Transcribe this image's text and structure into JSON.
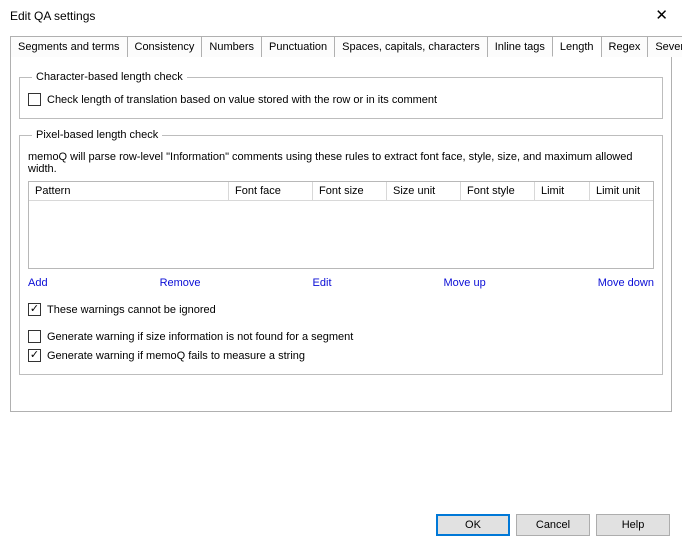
{
  "window": {
    "title": "Edit QA settings",
    "close_glyph": "✕"
  },
  "tabs": {
    "items": [
      {
        "label": "Segments and terms"
      },
      {
        "label": "Consistency"
      },
      {
        "label": "Numbers"
      },
      {
        "label": "Punctuation"
      },
      {
        "label": "Spaces, capitals, characters"
      },
      {
        "label": "Inline tags"
      },
      {
        "label": "Length"
      },
      {
        "label": "Regex"
      },
      {
        "label": "Severity"
      }
    ],
    "active_index": 6
  },
  "groups": {
    "char": {
      "legend": "Character-based length check",
      "checkbox_label": "Check length of translation based on value stored with the row or in its comment",
      "checked": false
    },
    "pixel": {
      "legend": "Pixel-based length check",
      "description": "memoQ will parse row-level \"Information\" comments using these rules to extract font face, style, size, and maximum allowed width.",
      "columns": {
        "pattern": "Pattern",
        "font_face": "Font face",
        "font_size": "Font size",
        "size_unit": "Size unit",
        "font_style": "Font style",
        "limit": "Limit",
        "limit_unit": "Limit unit"
      },
      "links": {
        "add": "Add",
        "remove": "Remove",
        "edit": "Edit",
        "move_up": "Move up",
        "move_down": "Move down"
      },
      "cb1": {
        "label": "These warnings cannot be ignored",
        "checked": true
      },
      "cb2": {
        "label": "Generate warning if size information is not found for a segment",
        "checked": false
      },
      "cb3": {
        "label": "Generate warning if memoQ fails to measure a string",
        "checked": true
      }
    }
  },
  "buttons": {
    "ok": "OK",
    "cancel": "Cancel",
    "help": "Help"
  }
}
